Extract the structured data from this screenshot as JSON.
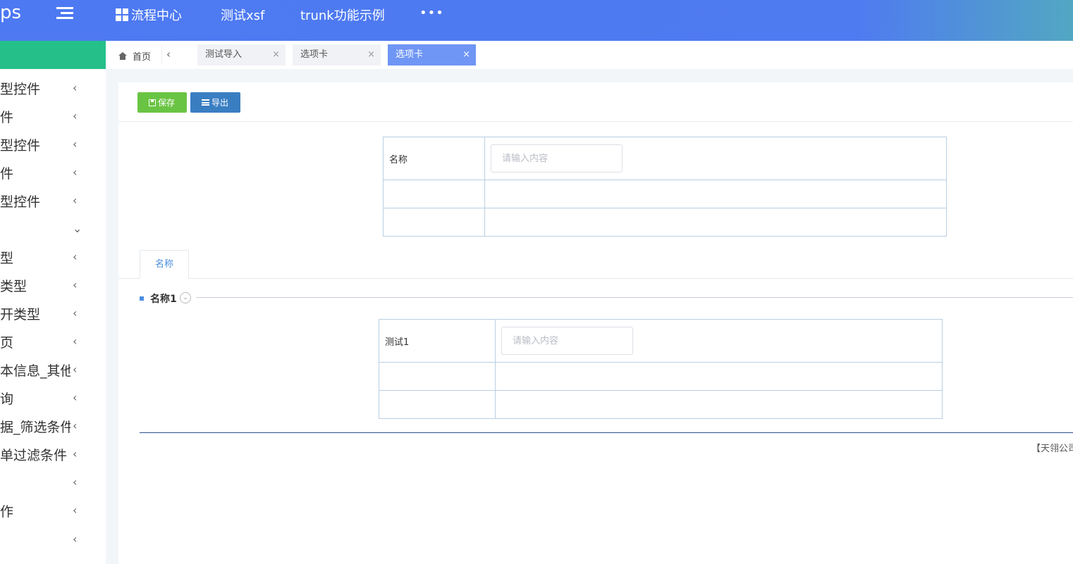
{
  "header": {
    "logo": "ps",
    "nav": [
      "流程中心",
      "测试xsf",
      "trunk功能示例"
    ],
    "more": "•••"
  },
  "sidebar": {
    "items": [
      {
        "label": "型控件",
        "chevron": "‹"
      },
      {
        "label": "件",
        "chevron": "‹"
      },
      {
        "label": "型控件",
        "chevron": "‹"
      },
      {
        "label": "件",
        "chevron": "‹"
      },
      {
        "label": "型控件",
        "chevron": "‹"
      },
      {
        "label": "",
        "chevron": "⌄"
      },
      {
        "label": "型",
        "chevron": "‹"
      },
      {
        "label": "类型",
        "chevron": "‹"
      },
      {
        "label": "开类型",
        "chevron": "‹"
      },
      {
        "label": "页",
        "chevron": "‹"
      },
      {
        "label": "本信息_其他",
        "chevron": "‹"
      },
      {
        "label": "询",
        "chevron": "‹"
      },
      {
        "label": "据_筛选条件",
        "chevron": "‹"
      },
      {
        "label": "单过滤条件",
        "chevron": "‹"
      },
      {
        "label": "",
        "chevron": "‹"
      },
      {
        "label": "作",
        "chevron": "‹"
      },
      {
        "label": "",
        "chevron": "‹"
      }
    ]
  },
  "tabbar": {
    "home": "首页",
    "prev": "‹",
    "tabs": [
      {
        "label": "测试导入",
        "close": "×"
      },
      {
        "label": "选项卡",
        "close": "×"
      },
      {
        "label": "选项卡",
        "close": "×"
      }
    ]
  },
  "toolbar": {
    "save_label": "保存",
    "export_label": "导出"
  },
  "form1": {
    "label": "名称",
    "placeholder": "请输入内容"
  },
  "subtabs": {
    "tab1": "名称"
  },
  "section": {
    "title": "名称1",
    "toggle": "⌄"
  },
  "form2": {
    "label": "测试1",
    "placeholder": "请输入内容"
  },
  "footer": {
    "text": "【天翎公司"
  },
  "colors": {
    "header_start": "#4d79f2",
    "header_end": "#52a7c2",
    "sidebar_accent": "#25c08a",
    "active_tab": "#6f96f5",
    "save_button": "#6ac443",
    "export_button": "#3a7ec2"
  }
}
